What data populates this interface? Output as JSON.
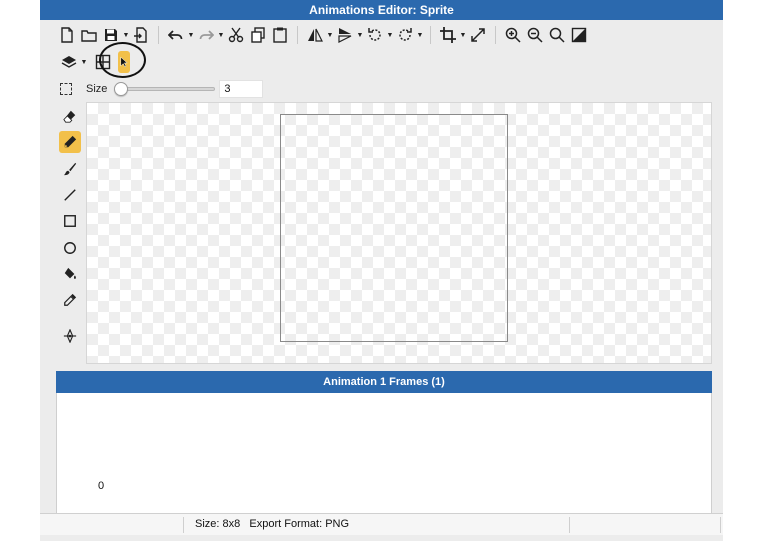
{
  "window": {
    "title": "Animations Editor: Sprite"
  },
  "toolbar": {
    "row1": [
      {
        "icon": "new-file-icon"
      },
      {
        "icon": "open-folder-icon"
      },
      {
        "icon": "save-icon",
        "caret": true
      },
      {
        "icon": "export-icon"
      },
      {
        "icon": "undo-icon",
        "caret": true
      },
      {
        "icon": "redo-icon",
        "caret": true
      },
      {
        "icon": "cut-icon"
      },
      {
        "icon": "copy-icon"
      },
      {
        "icon": "paste-icon"
      },
      {
        "icon": "flip-horizontal-icon",
        "caret": true
      },
      {
        "icon": "flip-vertical-icon",
        "caret": true
      },
      {
        "icon": "rotate-left-icon",
        "caret": true
      },
      {
        "icon": "rotate-right-icon",
        "caret": true
      },
      {
        "icon": "crop-icon",
        "caret": true
      },
      {
        "icon": "resize-icon"
      },
      {
        "icon": "zoom-in-icon"
      },
      {
        "icon": "zoom-out-icon"
      },
      {
        "icon": "zoom-fit-icon"
      },
      {
        "icon": "color-adjust-icon"
      }
    ],
    "row2": [
      {
        "icon": "layers-icon",
        "caret": true
      },
      {
        "icon": "grid-icon"
      },
      {
        "icon": "highlighted-button"
      }
    ]
  },
  "brush": {
    "size_label": "Size",
    "size_value": "3",
    "size_min": 1,
    "size_max": 64
  },
  "tools": [
    {
      "icon": "eraser-icon",
      "active": false
    },
    {
      "icon": "pencil-icon",
      "active": true
    },
    {
      "icon": "brush-icon",
      "active": false
    },
    {
      "icon": "line-icon",
      "active": false
    },
    {
      "icon": "rectangle-icon",
      "active": false
    },
    {
      "icon": "ellipse-icon",
      "active": false
    },
    {
      "icon": "paint-bucket-icon",
      "active": false
    },
    {
      "icon": "eyedropper-icon",
      "active": false
    },
    {
      "icon": "move-anchor-icon",
      "active": false
    }
  ],
  "frames": {
    "header": "Animation 1 Frames (1)",
    "items": [
      {
        "index": "0"
      }
    ]
  },
  "status": {
    "text": "Size: 8x8   Export Format: PNG"
  },
  "colors": {
    "accent": "#2b69ae",
    "highlight": "#f2c04a"
  }
}
